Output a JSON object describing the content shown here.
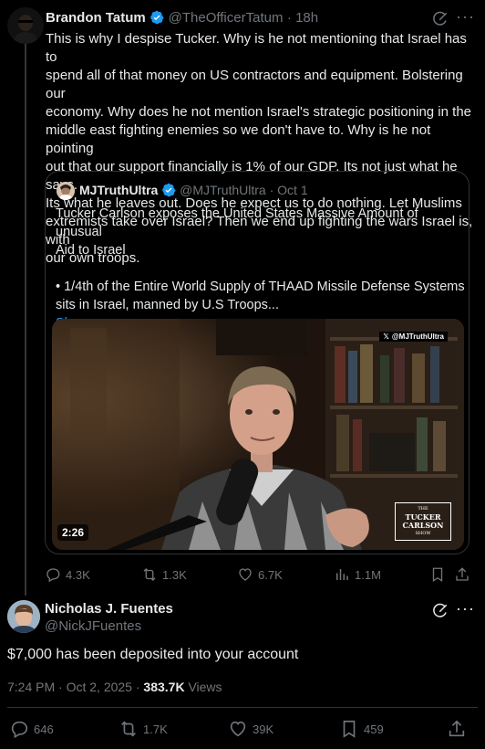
{
  "top_tweet": {
    "author_name": "Brandon Tatum",
    "author_handle": "@TheOfficerTatum",
    "time": "· 18h",
    "text_lines": [
      "This is why I despise Tucker. Why is he not mentioning that Israel has to",
      "spend all of that money on US contractors and equipment. Bolstering our",
      "economy. Why does he not mention Israel's strategic positioning in the",
      "middle east fighting enemies so we don't have to. Why is he not pointing",
      "out that our support financially is 1% of our GDP. Its not just what he says.",
      "Its what he leaves out. Does he expect us to do nothing. Let Muslims",
      "extremists take over Israel? Then we end up fighting the wars Israel is, with",
      "our own troops."
    ],
    "quote": {
      "author_name": "MJTruthUltra",
      "author_handle": "@MJTruthUltra",
      "time": "· Oct 1",
      "text_lines": [
        "Tucker Carlson exposes the United States Massive Amount of unusual",
        "Aid to Israel"
      ],
      "bullet_lines": [
        "• 1/4th of the Entire World Supply of THAAD Missile Defense Systems",
        "sits in Israel, manned by U.S Troops..."
      ],
      "show_more": "Show more",
      "video": {
        "duration": "2:26",
        "watermark": "@MJTruthUltra",
        "logo_line1": "THE",
        "logo_line2": "TUCKER",
        "logo_line3": "CARLSON",
        "logo_line4": "SHOW"
      }
    },
    "actions": {
      "replies": "4.3K",
      "reposts": "1.3K",
      "likes": "6.7K",
      "views": "1.1M"
    }
  },
  "reply_tweet": {
    "author_name": "Nicholas J. Fuentes",
    "author_handle": "@NickJFuentes",
    "text": "$7,000 has been deposited into your account",
    "timestamp": "7:24 PM · Oct 2, 2025 · ",
    "views_count": "383.7K",
    "views_label": " Views",
    "actions": {
      "replies": "646",
      "reposts": "1.7K",
      "likes": "39K",
      "bookmarks": "459"
    }
  },
  "colors": {
    "background": "#000000",
    "text": "#e7e9ea",
    "secondary": "#71767b",
    "accent": "#1d9bf0",
    "divider": "#2f3336"
  }
}
